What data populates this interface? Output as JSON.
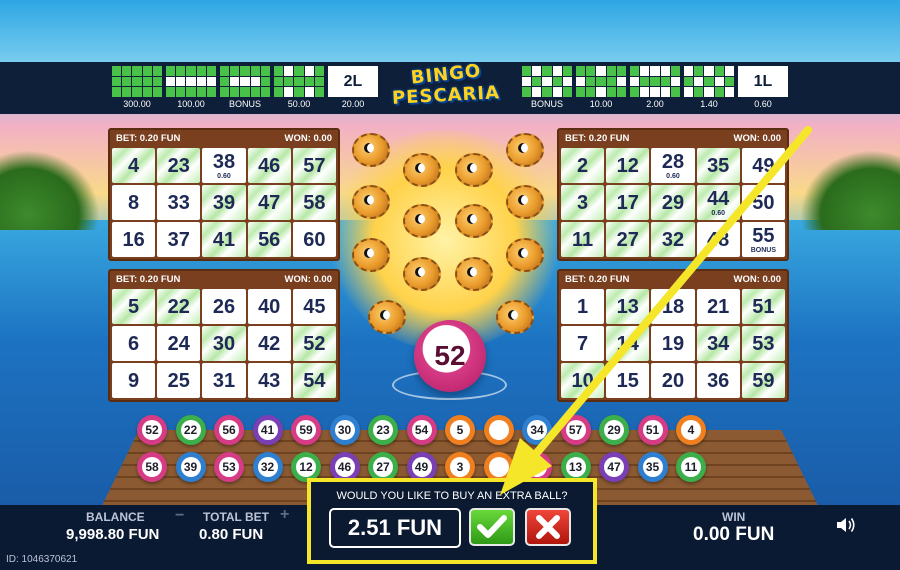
{
  "game_title": [
    "BINGO",
    "PESCARIA"
  ],
  "paylines_left": [
    "300.00",
    "100.00",
    "BONUS",
    "50.00",
    "20.00"
  ],
  "paylines_right": [
    "BONUS",
    "10.00",
    "2.00",
    "1.40",
    "0.60"
  ],
  "line_badges": {
    "left": "2L",
    "right": "1L"
  },
  "cards": [
    {
      "bet": "BET: 0.20 FUN",
      "won": "WON: 0.00",
      "cells": [
        [
          "4",
          "23",
          "38",
          "46",
          "57"
        ],
        [
          "8",
          "33",
          "39",
          "47",
          "58"
        ],
        [
          "16",
          "37",
          "41",
          "56",
          "60"
        ]
      ],
      "subs": {
        "0-2": "0.60"
      }
    },
    {
      "bet": "BET: 0.20 FUN",
      "won": "WON: 0.00",
      "cells": [
        [
          "2",
          "12",
          "28",
          "35",
          "49"
        ],
        [
          "3",
          "17",
          "29",
          "44",
          "50"
        ],
        [
          "11",
          "27",
          "32",
          "48",
          "55"
        ]
      ],
      "subs": {
        "0-2": "0.60",
        "1-3": "0.60",
        "2-4": "BONUS"
      }
    },
    {
      "bet": "BET: 0.20 FUN",
      "won": "WON: 0.00",
      "cells": [
        [
          "5",
          "22",
          "26",
          "40",
          "45"
        ],
        [
          "6",
          "24",
          "30",
          "42",
          "52"
        ],
        [
          "9",
          "25",
          "31",
          "43",
          "54"
        ]
      ],
      "subs": {}
    },
    {
      "bet": "BET: 0.20 FUN",
      "won": "WON: 0.00",
      "cells": [
        [
          "1",
          "13",
          "18",
          "21",
          "51"
        ],
        [
          "7",
          "14",
          "19",
          "34",
          "53"
        ],
        [
          "10",
          "15",
          "20",
          "36",
          "59"
        ]
      ],
      "subs": {}
    }
  ],
  "drawn_ball": "52",
  "balls_row1": [
    "52",
    "22",
    "56",
    "41",
    "59",
    "30",
    "23",
    "54",
    "5",
    "",
    "34",
    "57",
    "29",
    "51",
    "4"
  ],
  "balls_row2": [
    "58",
    "39",
    "53",
    "32",
    "12",
    "46",
    "27",
    "49",
    "3",
    "",
    "50",
    "13",
    "47",
    "35",
    "11"
  ],
  "balance_label": "BALANCE",
  "balance_value": "9,998.80 FUN",
  "total_bet_label": "TOTAL BET",
  "total_bet_value": "0.80 FUN",
  "minus": "−",
  "plus": "+",
  "win_label": "WIN",
  "win_value": "0.00 FUN",
  "extra_ball_question": "WOULD YOU LIKE TO BUY AN EXTRA BALL?",
  "extra_ball_price": "2.51 FUN",
  "session_id": "ID: 1046370621",
  "colors": {
    "highlight": "#f6e62a",
    "confirm": "#2e9a17",
    "cancel": "#b0160c"
  }
}
